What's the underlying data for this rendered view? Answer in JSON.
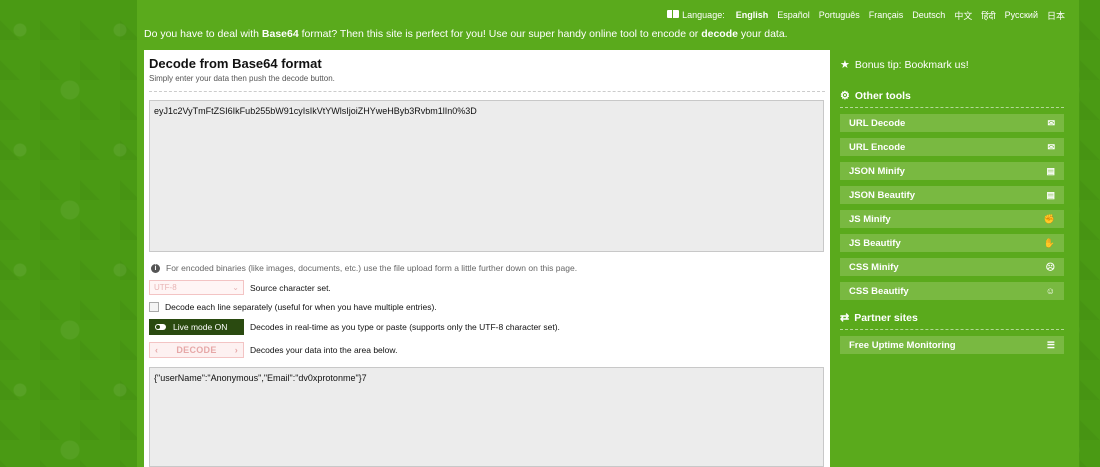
{
  "topbar": {
    "language_label": "Language:",
    "languages": [
      "English",
      "Español",
      "Português",
      "Français",
      "Deutsch",
      "中文",
      "हिंदी",
      "Русский",
      "日本"
    ]
  },
  "intro": {
    "part1": "Do you have to deal with ",
    "bold1": "Base64",
    "part2": " format? Then this site is perfect for you! Use our super handy online tool to encode or ",
    "bold2": "decode",
    "part3": " your data."
  },
  "main": {
    "title": "Decode from Base64 format",
    "subtitle": "Simply enter your data then push the decode button.",
    "input_value": "eyJ1c2VyTmFtZSI6IkFub255bW91cyIsIkVtYWlsIjoiZHYweHByb3Rvbm1lIn0%3D",
    "info_text": "For encoded binaries (like images, documents, etc.) use the file upload form a little further down on this page.",
    "charset_value": "UTF-8",
    "charset_label": "Source character set.",
    "each_line_label": "Decode each line separately (useful for when you have multiple entries).",
    "live_mode_label": "Live mode ON",
    "live_mode_desc": "Decodes in real-time as you type or paste (supports only the UTF-8 character set).",
    "decode_button": "DECODE",
    "decode_desc": "Decodes your data into the area below.",
    "output_value": "{\"userName\":\"Anonymous\",\"Email\":\"dv0xprotonme\"}7"
  },
  "sidebar": {
    "bonus": "Bonus tip: Bookmark us!",
    "other_tools_title": "Other tools",
    "tools": [
      {
        "label": "URL Decode",
        "icon": "envelope-open-icon",
        "glyph": "✉"
      },
      {
        "label": "URL Encode",
        "icon": "envelope-icon",
        "glyph": "✉"
      },
      {
        "label": "JSON Minify",
        "icon": "file-icon",
        "glyph": "▤"
      },
      {
        "label": "JSON Beautify",
        "icon": "file-code-icon",
        "glyph": "▤"
      },
      {
        "label": "JS Minify",
        "icon": "fist-icon",
        "glyph": "✊"
      },
      {
        "label": "JS Beautify",
        "icon": "hand-icon",
        "glyph": "✋"
      },
      {
        "label": "CSS Minify",
        "icon": "meh-face-icon",
        "glyph": "☹"
      },
      {
        "label": "CSS Beautify",
        "icon": "smile-face-icon",
        "glyph": "☺"
      }
    ],
    "partner_title": "Partner sites",
    "partners": [
      {
        "label": "Free Uptime Monitoring",
        "icon": "menu-icon",
        "glyph": "☰"
      }
    ]
  },
  "colors": {
    "page_green": "#5aaa1c",
    "button_green": "#79b941",
    "live_toggle": "#2a4a10"
  }
}
